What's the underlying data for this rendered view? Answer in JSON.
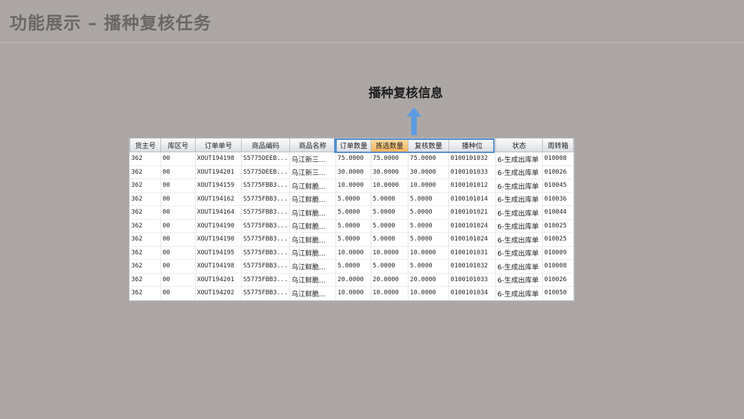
{
  "slide": {
    "title": "功能展示 – 播种复核任务",
    "callout": "播种复核信息"
  },
  "colors": {
    "background": "#aca7a5",
    "header_highlight": "#f2b35c",
    "highlight_border": "#4f8ccd",
    "arrow": "#5b9be0"
  },
  "icons": {
    "arrow": "arrow-up-icon"
  },
  "table": {
    "columns": [
      "货主号",
      "库区号",
      "订单单号",
      "商品编码",
      "商品名称",
      "订单数量",
      "拣选数量",
      "复核数量",
      "播种位",
      "状态",
      "周转箱"
    ],
    "highlighted_columns": [
      "订单数量",
      "拣选数量",
      "复核数量",
      "播种位"
    ],
    "selected_header": "拣选数量",
    "rows": [
      [
        "362",
        "00",
        "XOUT194198",
        "S5775DEEB...",
        "乌江新三...",
        "75.0000",
        "75.0000",
        "75.0000",
        "0100101032",
        "6-生成出库单",
        "010008"
      ],
      [
        "362",
        "00",
        "XOUT194201",
        "S5775DEEB...",
        "乌江新三...",
        "30.0000",
        "30.0000",
        "30.0000",
        "0100101033",
        "6-生成出库单",
        "010026"
      ],
      [
        "362",
        "00",
        "XOUT194159",
        "S5775FBB3...",
        "乌江鲜脆...",
        "10.0000",
        "10.0000",
        "10.0000",
        "0100101012",
        "6-生成出库单",
        "010045"
      ],
      [
        "362",
        "00",
        "XOUT194162",
        "S5775FBB3...",
        "乌江鲜脆...",
        "5.0000",
        "5.0000",
        "5.0000",
        "0100101014",
        "6-生成出库单",
        "010036"
      ],
      [
        "362",
        "00",
        "XOUT194164",
        "S5775FBB3...",
        "乌江鲜脆...",
        "5.0000",
        "5.0000",
        "5.0000",
        "0100101021",
        "6-生成出库单",
        "010044"
      ],
      [
        "362",
        "00",
        "XOUT194190",
        "S5775FBB3...",
        "乌江鲜脆...",
        "5.0000",
        "5.0000",
        "5.0000",
        "0100101024",
        "6-生成出库单",
        "010025"
      ],
      [
        "362",
        "00",
        "XOUT194190",
        "S5775FBB3...",
        "乌江鲜脆...",
        "5.0000",
        "5.0000",
        "5.0000",
        "0100101024",
        "6-生成出库单",
        "010025"
      ],
      [
        "362",
        "00",
        "XOUT194195",
        "S5775FBB3...",
        "乌江鲜脆...",
        "10.0000",
        "10.0000",
        "10.0000",
        "0100101031",
        "6-生成出库单",
        "010009"
      ],
      [
        "362",
        "00",
        "XOUT194198",
        "S5775FBB3...",
        "乌江鲜脆...",
        "5.0000",
        "5.0000",
        "5.0000",
        "0100101032",
        "6-生成出库单",
        "010008"
      ],
      [
        "362",
        "00",
        "XOUT194201",
        "S5775FBB3...",
        "乌江鲜脆...",
        "20.0000",
        "20.0000",
        "20.0000",
        "0100101033",
        "6-生成出库单",
        "010026"
      ],
      [
        "362",
        "00",
        "XOUT194202",
        "S5775FBB3...",
        "乌江鲜脆...",
        "10.0000",
        "10.0000",
        "10.0000",
        "0100101034",
        "6-生成出库单",
        "010050"
      ]
    ]
  }
}
